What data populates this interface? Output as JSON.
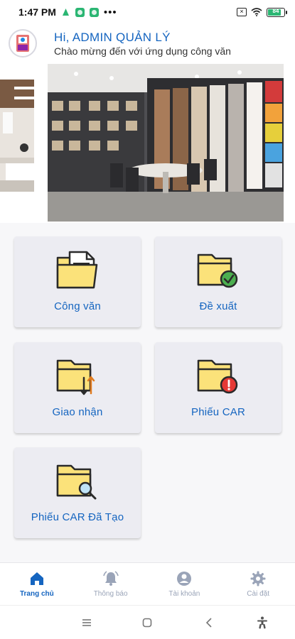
{
  "status_bar": {
    "time": "1:47 PM",
    "overflow": "•••",
    "battery_level": "84",
    "battery_fraction": 0.84
  },
  "header": {
    "greeting": "Hi, ADMIN QUẢN LÝ",
    "subtitle": "Chào mừng đến với ứng dụng công văn"
  },
  "tiles": [
    {
      "label": "Công văn",
      "icon": "folder-document-icon"
    },
    {
      "label": "Đề xuất",
      "icon": "folder-check-icon"
    },
    {
      "label": "Giao nhận",
      "icon": "folder-transfer-icon"
    },
    {
      "label": "Phiếu CAR",
      "icon": "folder-alert-icon"
    },
    {
      "label": "Phiếu CAR Đã Tạo",
      "icon": "folder-search-icon"
    }
  ],
  "bottom_nav": {
    "items": [
      {
        "label": "Trang chủ",
        "icon": "home-icon",
        "active": true
      },
      {
        "label": "Thông báo",
        "icon": "bell-icon",
        "active": false
      },
      {
        "label": "Tài khoản",
        "icon": "account-icon",
        "active": false
      },
      {
        "label": "Cài đặt",
        "icon": "gear-icon",
        "active": false
      }
    ]
  },
  "colors": {
    "accent": "#1565c0",
    "tile_bg": "#ececf2",
    "folder": "#fbe27a",
    "nav_inactive": "#9aa4b8"
  }
}
